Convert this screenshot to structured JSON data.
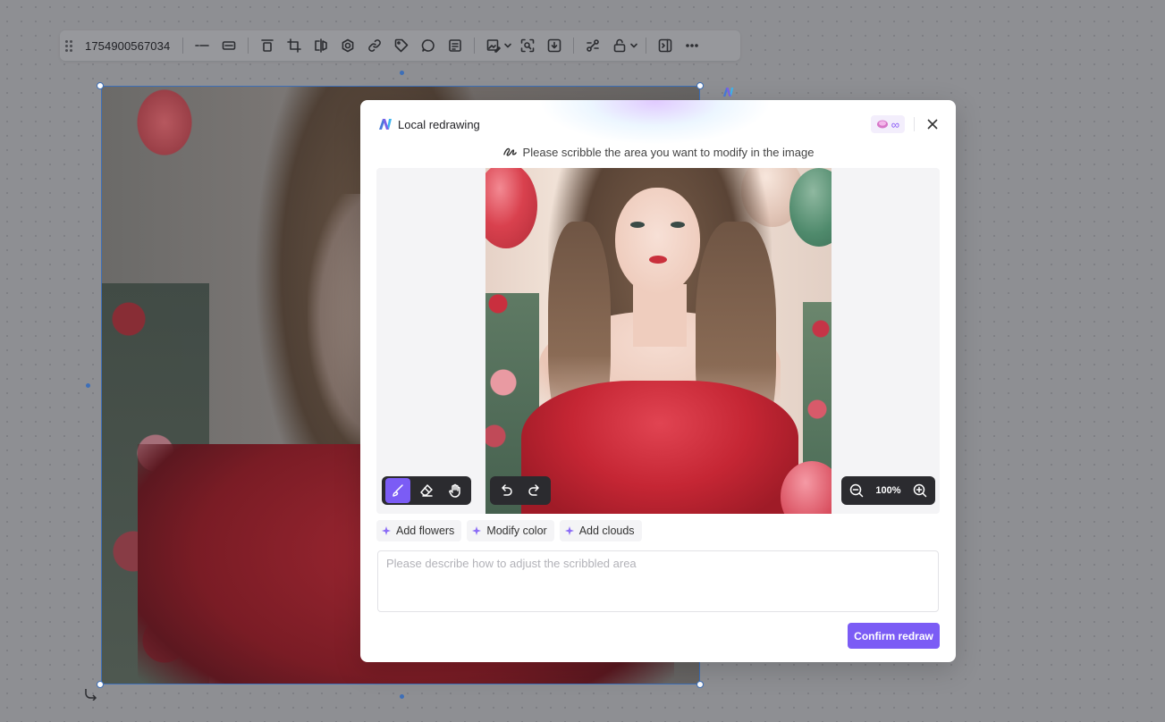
{
  "toolbar": {
    "id_label": "1754900567034",
    "buttons": [
      {
        "name": "line-style-icon"
      },
      {
        "name": "border-icon"
      },
      {
        "name": "align-icon"
      },
      {
        "name": "crop-icon"
      },
      {
        "name": "flip-icon"
      },
      {
        "name": "settings-icon"
      },
      {
        "name": "link-icon"
      },
      {
        "name": "tag-icon"
      },
      {
        "name": "comment-icon"
      },
      {
        "name": "note-icon"
      },
      {
        "name": "image-edit-icon"
      },
      {
        "name": "zoom-detail-icon"
      },
      {
        "name": "download-icon"
      },
      {
        "name": "connect-icon"
      },
      {
        "name": "lock-icon"
      },
      {
        "name": "panel-icon"
      },
      {
        "name": "more-icon"
      }
    ]
  },
  "modal": {
    "title": "Local redrawing",
    "credits_symbol": "∞",
    "hint": "Please scribble the area you want to modify in the image",
    "zoom_level": "100%",
    "tools": [
      {
        "name": "brush-icon",
        "active": true
      },
      {
        "name": "eraser-icon",
        "active": false
      },
      {
        "name": "hand-icon",
        "active": false
      }
    ],
    "suggestions": [
      {
        "label": "Add flowers"
      },
      {
        "label": "Modify color"
      },
      {
        "label": "Add clouds"
      }
    ],
    "prompt_placeholder": "Please describe how to adjust the scribbled area",
    "prompt_value": "",
    "confirm_label": "Confirm redraw"
  },
  "colors": {
    "accent": "#7b5cf5",
    "selection": "#3d6fb8",
    "dark_toolbar": "#2b2b2f"
  }
}
